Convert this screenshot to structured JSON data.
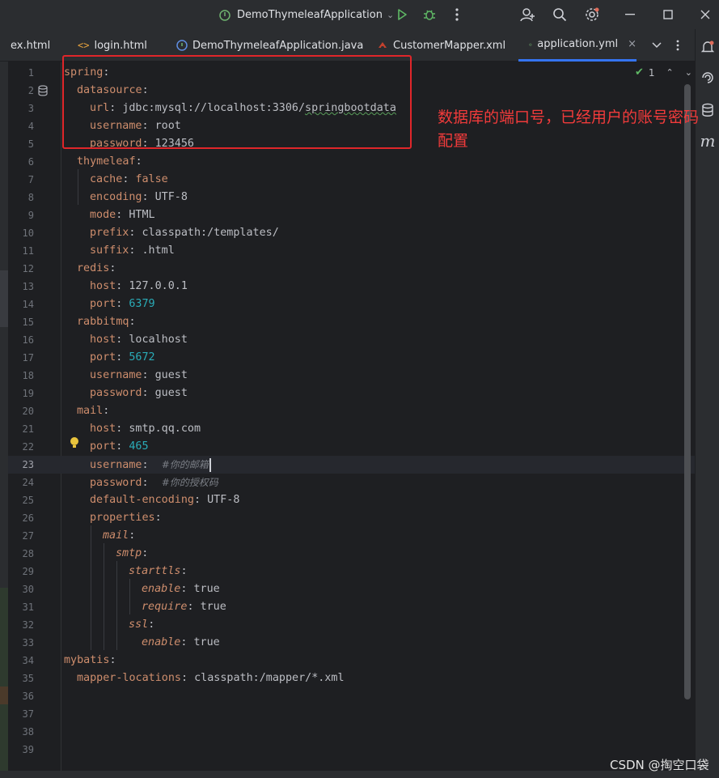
{
  "titlebar": {
    "run_config": "DemoThymeleafApplication",
    "icons": [
      "run-icon",
      "debug-icon",
      "more-icon",
      "add-user-icon",
      "search-icon",
      "settings-icon",
      "minimize-icon",
      "maximize-icon",
      "close-icon"
    ]
  },
  "tabs": [
    {
      "label": "ex.html",
      "icon": "html-file-icon"
    },
    {
      "label": "login.html",
      "icon": "html-tag-icon"
    },
    {
      "label": "DemoThymeleafApplication.java",
      "icon": "spring-class-icon"
    },
    {
      "label": "CustomerMapper.xml",
      "icon": "mybatis-icon"
    },
    {
      "label": "application.yml",
      "icon": "spring-yml-icon",
      "active": true,
      "close": "×"
    }
  ],
  "inspection": {
    "count": "1"
  },
  "lines": [
    {
      "n": "1"
    },
    {
      "n": "2"
    },
    {
      "n": "3"
    },
    {
      "n": "4"
    },
    {
      "n": "5"
    },
    {
      "n": "6"
    },
    {
      "n": "7"
    },
    {
      "n": "8"
    },
    {
      "n": "9"
    },
    {
      "n": "10"
    },
    {
      "n": "11"
    },
    {
      "n": "12"
    },
    {
      "n": "13"
    },
    {
      "n": "14"
    },
    {
      "n": "15"
    },
    {
      "n": "16"
    },
    {
      "n": "17"
    },
    {
      "n": "18"
    },
    {
      "n": "19"
    },
    {
      "n": "20"
    },
    {
      "n": "21"
    },
    {
      "n": "22"
    },
    {
      "n": "23"
    },
    {
      "n": "24"
    },
    {
      "n": "25"
    },
    {
      "n": "26"
    },
    {
      "n": "27"
    },
    {
      "n": "28"
    },
    {
      "n": "29"
    },
    {
      "n": "30"
    },
    {
      "n": "31"
    },
    {
      "n": "32"
    },
    {
      "n": "33"
    },
    {
      "n": "34"
    },
    {
      "n": "35"
    },
    {
      "n": "36"
    },
    {
      "n": "37"
    },
    {
      "n": "38"
    },
    {
      "n": "39"
    }
  ],
  "code": {
    "l1_key": "spring",
    "l2_key": "datasource",
    "l3_key": "url",
    "l3_val": "jdbc:mysql://localhost:3306/",
    "l3_val2": "springbootdata",
    "l4_key": "username",
    "l4_val": "root",
    "l5_key": "password",
    "l5_val": "123456",
    "l6_key": "thymeleaf",
    "l7_key": "cache",
    "l7_val": "false",
    "l8_key": "encoding",
    "l8_val": "UTF-8",
    "l9_key": "mode",
    "l9_val": "HTML",
    "l10_key": "prefix",
    "l10_val": "classpath:/templates/",
    "l11_key": "suffix",
    "l11_val": ".html",
    "l12_key": "redis",
    "l13_key": "host",
    "l13_val": "127.0.0.1",
    "l14_key": "port",
    "l14_val": "6379",
    "l15_key": "rabbitmq",
    "l16_key": "host",
    "l16_val": "localhost",
    "l17_key": "port",
    "l17_val": "5672",
    "l18_key": "username",
    "l18_val": "guest",
    "l19_key": "password",
    "l19_val": "guest",
    "l20_key": "mail",
    "l21_key": "host",
    "l21_val": "smtp.qq.com",
    "l22_key": "port",
    "l22_val": "465",
    "l23_key": "username",
    "l23_comment": "#你的邮箱",
    "l24_key": "password",
    "l24_comment": "#你的授权码",
    "l25_key": "default-encoding",
    "l25_val": "UTF-8",
    "l26_key": "properties",
    "l27_key": "mail",
    "l28_key": "smtp",
    "l29_key": "starttls",
    "l30_key": "enable",
    "l30_val": "true",
    "l31_key": "require",
    "l31_val": "true",
    "l32_key": "ssl",
    "l33_key": "enable",
    "l33_val": "true",
    "l34_key": "mybatis",
    "l35_key": "mapper-locations",
    "l35_val": "classpath:/mapper/*.xml"
  },
  "annotation": "数据库的端口号，已经用户的账号密码配置",
  "watermark": "CSDN @掏空口袋",
  "colors": {
    "accent": "#3574f0",
    "annotation": "#e0262a",
    "key": "#cf8e6d",
    "number": "#2aacb8"
  }
}
